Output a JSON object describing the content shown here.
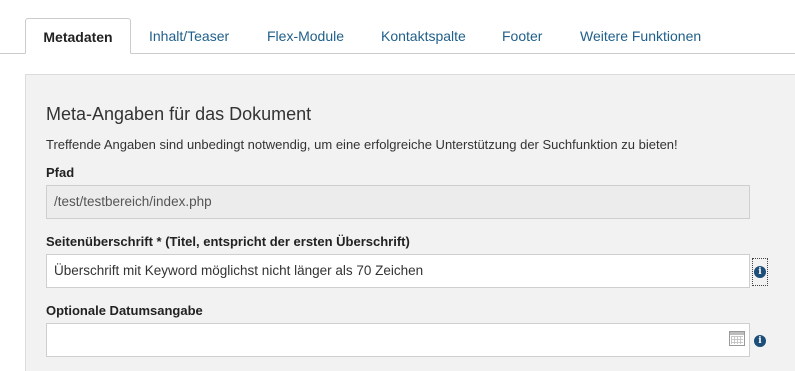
{
  "tabs": [
    {
      "label": "Metadaten",
      "active": true
    },
    {
      "label": "Inhalt/Teaser",
      "active": false
    },
    {
      "label": "Flex-Module",
      "active": false
    },
    {
      "label": "Kontaktspalte",
      "active": false
    },
    {
      "label": "Footer",
      "active": false
    },
    {
      "label": "Weitere Funktionen",
      "active": false
    }
  ],
  "section": {
    "title": "Meta-Angaben für das Dokument",
    "description": "Treffende Angaben sind unbedingt notwendig, um eine erfolgreiche Unterstützung der Suchfunktion zu bieten!"
  },
  "fields": {
    "pfad": {
      "label": "Pfad",
      "value": "/test/testbereich/index.php"
    },
    "seitenueberschrift": {
      "label": "Seitenüberschrift * (Titel, entspricht der ersten Überschrift)",
      "value": "Überschrift mit Keyword möglichst nicht länger als 70 Zeichen"
    },
    "datum": {
      "label": "Optionale Datumsangabe",
      "value": ""
    }
  },
  "icons": {
    "info_glyph": "i",
    "info": "info-icon",
    "calendar": "calendar-icon"
  },
  "colors": {
    "tab_link": "#1f5f8b",
    "panel_bg": "#f2f2f2",
    "info_icon": "#1d4e79"
  }
}
